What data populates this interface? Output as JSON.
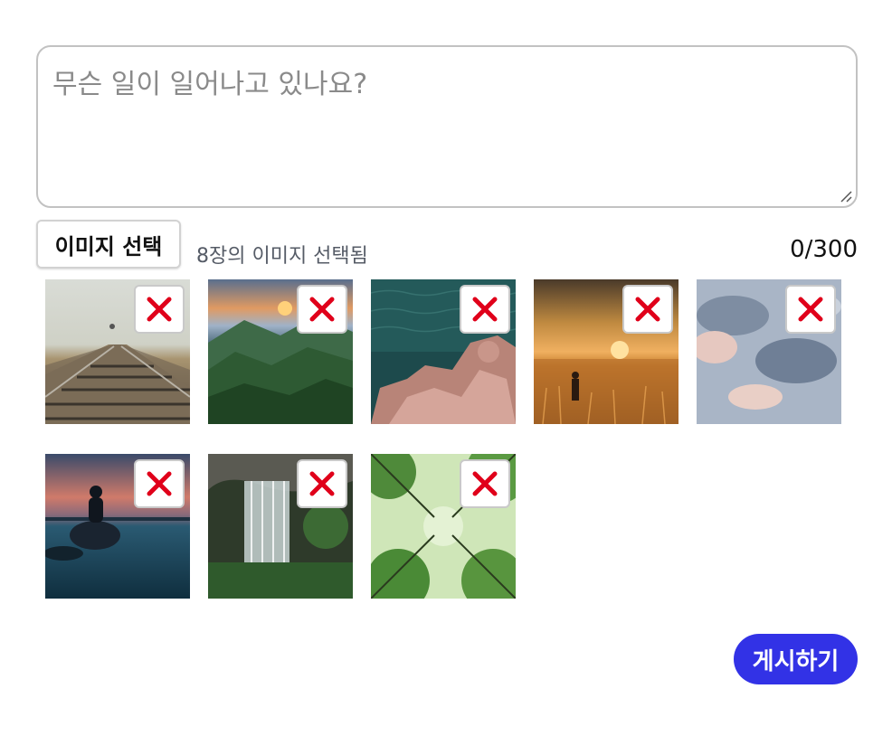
{
  "composer": {
    "placeholder": "무슨 일이 일어나고 있나요?",
    "value": ""
  },
  "toolbar": {
    "select_images_label": "이미지 선택",
    "selected_count_text": "8장의 이미지 선택됨",
    "char_count": "0/300"
  },
  "images": [
    {
      "alt": "railway-tracks",
      "remove_icon": "close-icon"
    },
    {
      "alt": "mountain-sunset",
      "remove_icon": "close-icon"
    },
    {
      "alt": "sea-rocks",
      "remove_icon": "close-icon"
    },
    {
      "alt": "field-sunset",
      "remove_icon": "close-icon"
    },
    {
      "alt": "cloudy-sky",
      "remove_icon": "close-icon"
    },
    {
      "alt": "person-on-rock",
      "remove_icon": "close-icon"
    },
    {
      "alt": "waterfall",
      "remove_icon": "close-icon"
    },
    {
      "alt": "forest-canopy",
      "remove_icon": "close-icon"
    }
  ],
  "actions": {
    "post_label": "게시하기"
  },
  "colors": {
    "accent": "#3232e6",
    "remove_x": "#e0001a"
  }
}
